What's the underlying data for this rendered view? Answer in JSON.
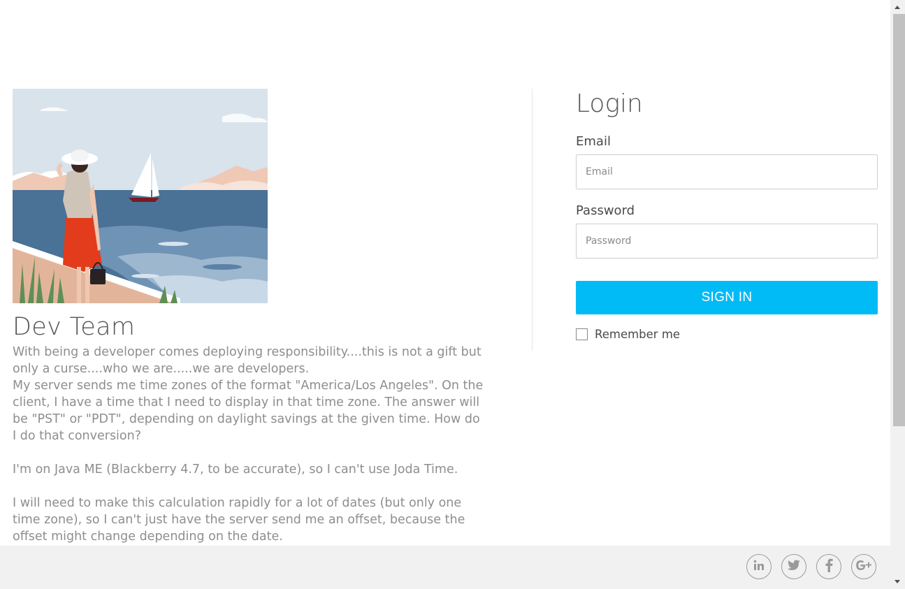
{
  "hero": {
    "image_alt": "woman-by-sea-illustration"
  },
  "team": {
    "title": "Dev Team",
    "paragraphs": [
      "With being a developer comes deploying responsibility....this is not a gift but only a curse....who we are.....we are developers.",
      "My server sends me time zones of the format \"America/Los Angeles\". On the client, I have a time that I need to display in that time zone. The answer will be \"PST\" or \"PDT\", depending on daylight savings at the given time. How do I do that conversion?",
      "I'm on Java ME (Blackberry 4.7, to be accurate), so I can't use Joda Time.",
      "I will need to make this calculation rapidly for a lot of dates (but only one time zone), so I can't just have the server send me an offset, because the offset might change depending on the date."
    ]
  },
  "login": {
    "title": "Login",
    "email_label": "Email",
    "email_placeholder": "Email",
    "email_value": "",
    "password_label": "Password",
    "password_placeholder": "Password",
    "password_value": "",
    "signin_label": "SIGN IN",
    "remember_label": "Remember me",
    "remember_checked": false
  },
  "footer": {
    "social": [
      {
        "name": "linkedin",
        "icon": "linkedin-icon"
      },
      {
        "name": "twitter",
        "icon": "twitter-icon"
      },
      {
        "name": "facebook",
        "icon": "facebook-icon"
      },
      {
        "name": "google-plus",
        "icon": "google-plus-icon"
      }
    ]
  },
  "colors": {
    "accent": "#00bbf6",
    "footer_bg": "#f1f1f1",
    "text_muted": "#8e8e8e"
  }
}
